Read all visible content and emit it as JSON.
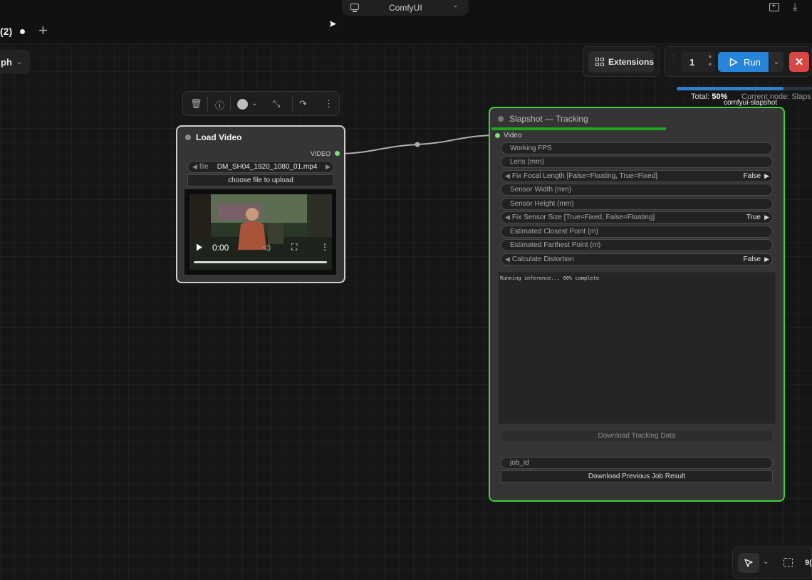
{
  "topbar": {
    "workflow_title": "ComfyUI",
    "tab_label": "(2)",
    "tab_add": "+"
  },
  "graph_selector": {
    "label": "ph",
    "chevron": "⌄"
  },
  "toolbar": {
    "extensions_label": "Extensions",
    "batch_count": "1",
    "run_label": "Run",
    "stop_symbol": "✕"
  },
  "progress": {
    "total_label": "Total:",
    "total_value": "50%",
    "fraction": 0.5,
    "current_node": "Current node: Slaps"
  },
  "load_video": {
    "title": "Load Video",
    "output_label": "VIDEO",
    "file_label": "file",
    "file_value": "DM_SH04_1920_1080_01.mp4",
    "upload_label": "choose file to upload",
    "time": "0:00"
  },
  "slapshot": {
    "badge": "comfyui-slapshot",
    "title": "Slapshot — Tracking",
    "input_label": "Video",
    "fields": {
      "working_fps": "Working FPS",
      "lens": "Lens (mm)",
      "fix_focal_length_label": "Fix Focal Length  [False=Floating, True=Fixed]",
      "fix_focal_length_value": "False",
      "sensor_width": "Sensor Width (mm)",
      "sensor_height": "Sensor Height (mm)",
      "fix_sensor_size_label": "Fix Sensor Size  [True=Fixed, False=Floating]",
      "fix_sensor_size_value": "True",
      "closest_point": "Estimated Closest Point (m)",
      "farthest_point": "Estimated Farthest Point (m)",
      "calc_distortion_label": "Calculate Distortion",
      "calc_distortion_value": "False"
    },
    "console_text": "Running inference... 60% complete",
    "inference_progress": 0.6,
    "download_tracking": "Download Tracking Data",
    "job_id_placeholder": "job_id",
    "download_previous": "Download Previous Job Result"
  },
  "canvas_controls": {
    "zoom": "9("
  },
  "colors": {
    "accent": "#2684d9",
    "running": "#3fd13f",
    "stop": "#d94646"
  }
}
